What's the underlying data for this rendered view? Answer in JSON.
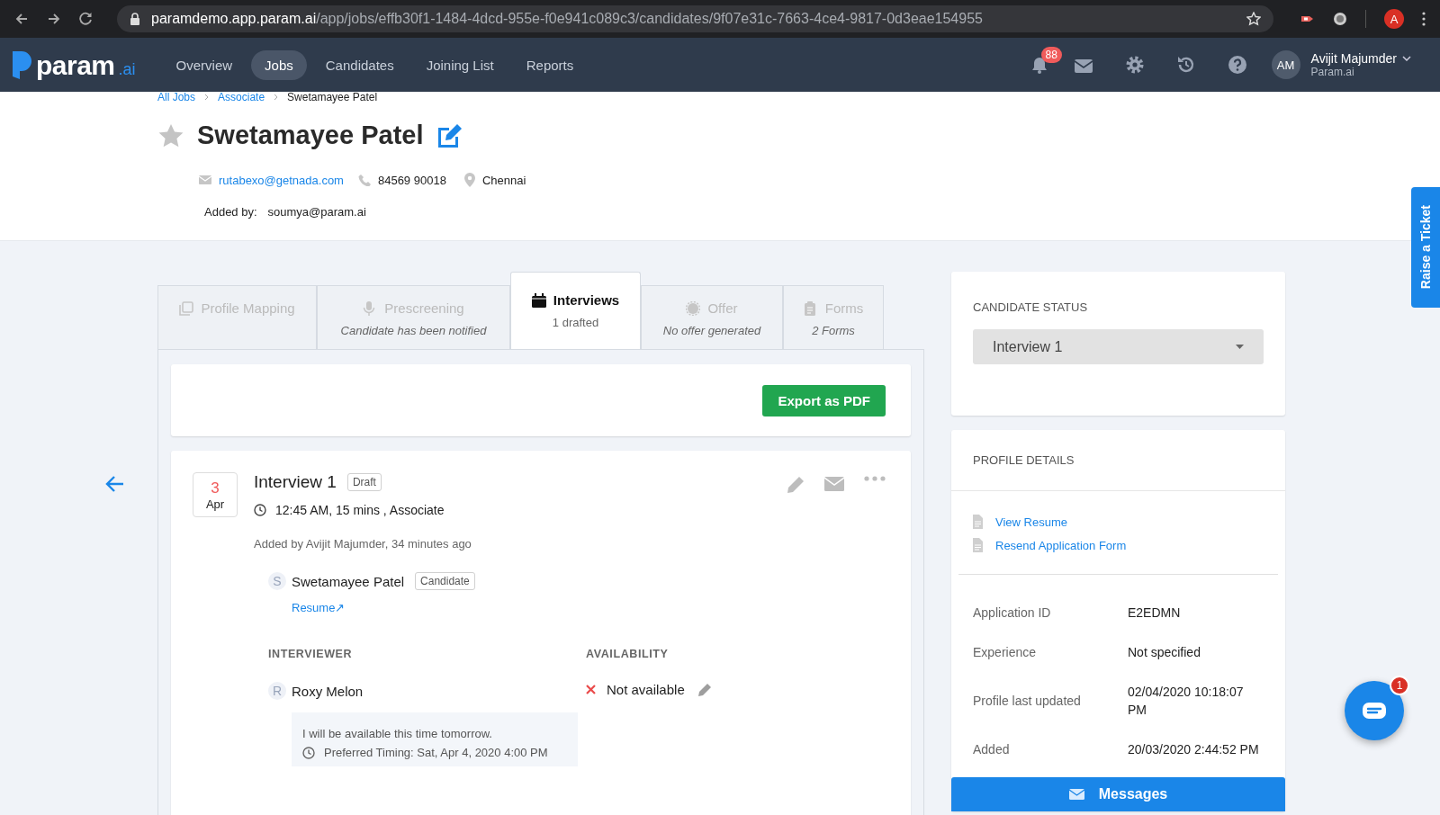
{
  "browser": {
    "url_host": "paramdemo.app.param.ai",
    "url_path": "/app/jobs/effb30f1-1484-4dcd-955e-f0e941c089c3/candidates/9f07e31c-7663-4ce4-9817-0d3eae154955",
    "profile_initial": "A"
  },
  "topnav": {
    "logo": "param",
    "logo_suffix": ".ai",
    "items": [
      {
        "label": "Overview",
        "selected": false
      },
      {
        "label": "Jobs",
        "selected": true
      },
      {
        "label": "Candidates",
        "selected": false
      },
      {
        "label": "Joining List",
        "selected": false
      },
      {
        "label": "Reports",
        "selected": false
      }
    ],
    "notification_count": "88",
    "user_initials": "AM",
    "user_name": "Avijit Majumder",
    "user_org": "Param.ai"
  },
  "breadcrumb": [
    {
      "label": "All Jobs",
      "link": true
    },
    {
      "label": "Associate",
      "link": true
    },
    {
      "label": "Swetamayee Patel",
      "link": false
    }
  ],
  "candidate": {
    "name": "Swetamayee Patel",
    "starred": false,
    "email": "rutabexo@getnada.com",
    "phone": "84569 90018",
    "location": "Chennai",
    "added_by_label": "Added by:",
    "added_by": "soumya@param.ai"
  },
  "tabs": [
    {
      "title": "Profile Mapping",
      "selected": false
    },
    {
      "title": "Prescreening",
      "subtitle": "Candidate has been notified",
      "selected": false
    },
    {
      "title": "Interviews",
      "subtitle": "1 drafted",
      "selected": true
    },
    {
      "title": "Offer",
      "subtitle": "No offer generated",
      "selected": false
    },
    {
      "title": "Forms",
      "subtitle": "2 Forms",
      "selected": false
    }
  ],
  "export_button": "Export as PDF",
  "interview": {
    "day": "3",
    "month": "Apr",
    "title": "Interview 1",
    "status": "Draft",
    "details": "12:45 AM, 15 mins , Associate",
    "added": "Added by Avijit Majumder, 34 minutes ago",
    "candidate": {
      "initial": "S",
      "name": "Swetamayee Patel",
      "role": "Candidate",
      "link": "Resume↗"
    },
    "interviewer_heading": "INTERVIEWER",
    "availability_heading": "AVAILABILITY",
    "interviewer": {
      "initial": "R",
      "name": "Roxy Melon",
      "available": false,
      "availability": "Not available",
      "note": "I will be available this time tomorrow.",
      "preferred": "Preferred Timing: Sat, Apr 4, 2020 4:00 PM"
    }
  },
  "status_card": {
    "heading": "CANDIDATE STATUS",
    "value": "Interview 1"
  },
  "profile_card": {
    "heading": "PROFILE DETAILS",
    "links": [
      "View Resume",
      "Resend Application Form"
    ],
    "rows": [
      {
        "label": "Application ID",
        "value": "E2EDMN"
      },
      {
        "label": "Experience",
        "value": "Not specified"
      },
      {
        "label": "Profile last updated",
        "value": "02/04/2020 10:18:07 PM"
      },
      {
        "label": "Added",
        "value": "20/03/2020 2:44:52 PM"
      }
    ]
  },
  "messages_button": "Messages",
  "ticket_tab": "Raise a Ticket",
  "chat_badge": "1"
}
